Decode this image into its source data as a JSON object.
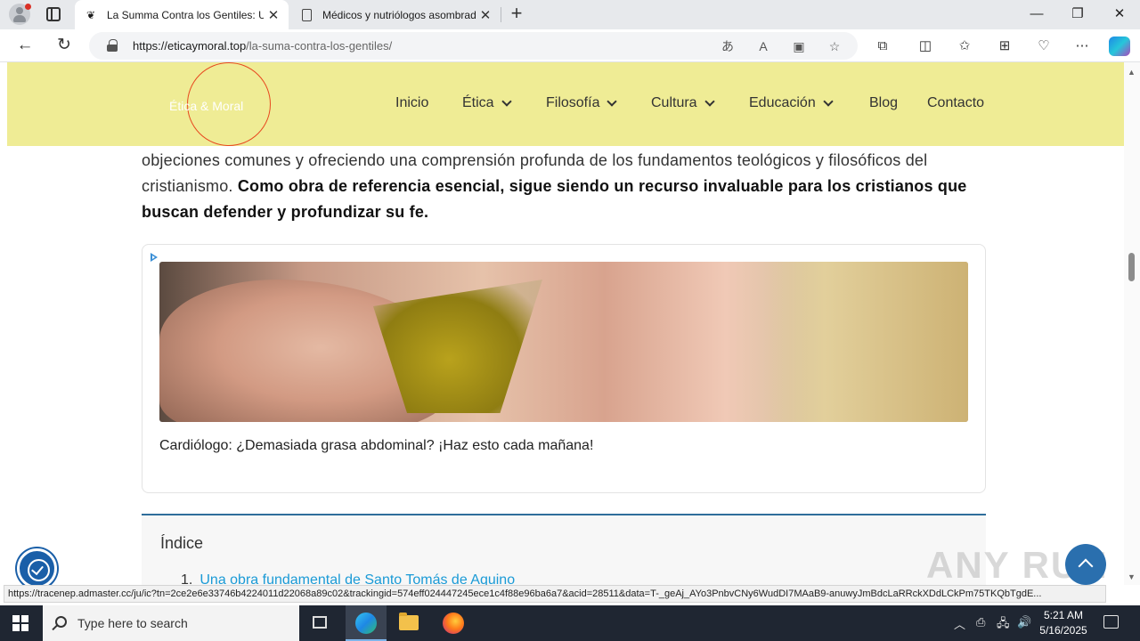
{
  "browser": {
    "tabs": [
      {
        "title": "La Summa Contra los Gentiles: U",
        "favicon": "ethics-logo-icon",
        "active": true
      },
      {
        "title": "Médicos y nutriólogos asombrad",
        "favicon": "document-icon",
        "active": false
      }
    ],
    "url_domain": "https://eticaymoral.top",
    "url_path": "/la-suma-contra-los-gentiles/",
    "status_url": "https://tracenep.admaster.cc/ju/ic?tn=2ce2e6e33746b4224011d22068a89c02&trackingid=574eff024447245ece1c4f88e96ba6a7&acid=28511&data=T-_geAj_AYo3PnbvCNy6WudDI7MAaB9-anuwyJmBdcLaRRckXDdLCkPm75TKQbTgdE..."
  },
  "site": {
    "logo": "Ética & Moral",
    "menu": {
      "inicio": "Inicio",
      "etica": "Ética",
      "filosofia": "Filosofía",
      "cultura": "Cultura",
      "educacion": "Educación",
      "blog": "Blog",
      "contacto": "Contacto"
    }
  },
  "article": {
    "line1": "objeciones comunes y ofreciendo una comprensión profunda de los fundamentos teológicos y filosóficos del",
    "line2_plain": "cristianismo. ",
    "line2_bold": "Como obra de referencia esencial, sigue siendo un recurso invaluable para los cristianos que",
    "line3_bold": "buscan defender y profundizar su fe."
  },
  "ad": {
    "caption": "Cardiólogo: ¿Demasiada grasa abdominal? ¡Haz esto cada mañana!"
  },
  "toc": {
    "title": "Índice",
    "items": [
      {
        "number": "1",
        "text": "Una obra fundamental de Santo Tomás de Aquino"
      }
    ]
  },
  "watermark": "ANY RUN",
  "taskbar": {
    "search_placeholder": "Type here to search",
    "time": "5:21 AM",
    "date": "5/16/2025"
  },
  "colors": {
    "header_bg": "#efec95",
    "logo_ring": "#e8481f",
    "link": "#1a9ad6",
    "toc_border": "#2f6e9b",
    "taskbar": "#1f2632"
  }
}
